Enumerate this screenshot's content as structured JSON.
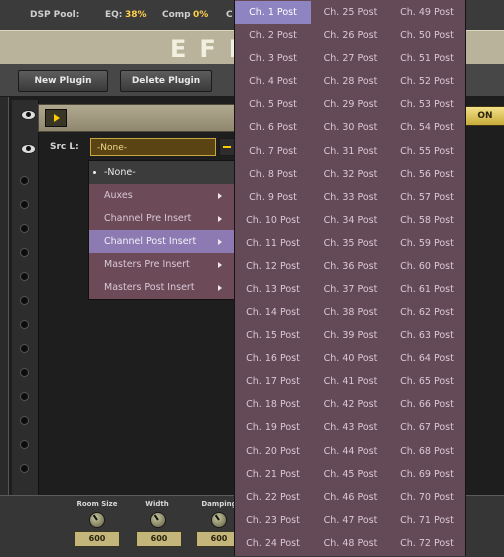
{
  "topbar": {
    "dsp_label": "DSP Pool:",
    "eq_label": "EQ:",
    "eq_value": "38%",
    "comp_label": "Comp",
    "comp_value": "0%",
    "extra_label": "C"
  },
  "header": {
    "title": "EFFECTS RACK"
  },
  "toolbar": {
    "new_plugin": "New Plugin",
    "delete_plugin": "Delete Plugin"
  },
  "plugin": {
    "on_label": "ON",
    "src_label": "Src L:",
    "src_value": "-None-"
  },
  "source_menu": [
    {
      "label": "-None-",
      "checked": true,
      "submenu": false
    },
    {
      "label": "Auxes",
      "submenu": true
    },
    {
      "label": "Channel Pre Insert",
      "submenu": true
    },
    {
      "label": "Channel Post Insert",
      "submenu": true,
      "active": true
    },
    {
      "label": "Masters Pre Insert",
      "submenu": true
    },
    {
      "label": "Masters Post Insert",
      "submenu": true
    }
  ],
  "channel_submenu": {
    "highlighted": "Ch. 1 Post",
    "columns": [
      [
        "Ch. 1 Post",
        "Ch. 2 Post",
        "Ch. 3 Post",
        "Ch. 4 Post",
        "Ch. 5 Post",
        "Ch. 6 Post",
        "Ch. 7 Post",
        "Ch. 8 Post",
        "Ch. 9 Post",
        "Ch. 10 Post",
        "Ch. 11 Post",
        "Ch. 12 Post",
        "Ch. 13 Post",
        "Ch. 14 Post",
        "Ch. 15 Post",
        "Ch. 16 Post",
        "Ch. 17 Post",
        "Ch. 18 Post",
        "Ch. 19 Post",
        "Ch. 20 Post",
        "Ch. 21 Post",
        "Ch. 22 Post",
        "Ch. 23 Post",
        "Ch. 24 Post"
      ],
      [
        "Ch. 25 Post",
        "Ch. 26 Post",
        "Ch. 27 Post",
        "Ch. 28 Post",
        "Ch. 29 Post",
        "Ch. 30 Post",
        "Ch. 31 Post",
        "Ch. 32 Post",
        "Ch. 33 Post",
        "Ch. 34 Post",
        "Ch. 35 Post",
        "Ch. 36 Post",
        "Ch. 37 Post",
        "Ch. 38 Post",
        "Ch. 39 Post",
        "Ch. 40 Post",
        "Ch. 41 Post",
        "Ch. 42 Post",
        "Ch. 43 Post",
        "Ch. 44 Post",
        "Ch. 45 Post",
        "Ch. 46 Post",
        "Ch. 47 Post",
        "Ch. 48 Post"
      ],
      [
        "Ch. 49 Post",
        "Ch. 50 Post",
        "Ch. 51 Post",
        "Ch. 52 Post",
        "Ch. 53 Post",
        "Ch. 54 Post",
        "Ch. 55 Post",
        "Ch. 56 Post",
        "Ch. 57 Post",
        "Ch. 58 Post",
        "Ch. 59 Post",
        "Ch. 60 Post",
        "Ch. 61 Post",
        "Ch. 62 Post",
        "Ch. 63 Post",
        "Ch. 64 Post",
        "Ch. 65 Post",
        "Ch. 66 Post",
        "Ch. 67 Post",
        "Ch. 68 Post",
        "Ch. 69 Post",
        "Ch. 70 Post",
        "Ch. 71 Post",
        "Ch. 72 Post"
      ]
    ]
  },
  "controls": [
    {
      "label": "Room Size",
      "value": "600"
    },
    {
      "label": "Width",
      "value": "600"
    },
    {
      "label": "Damping",
      "value": "600"
    }
  ],
  "colors": {
    "menu_bg": "#6c4a57",
    "menu_highlight": "#8d7ab2",
    "submenu_highlight": "#8f84c2",
    "accent_yellow": "#ffcc00"
  }
}
